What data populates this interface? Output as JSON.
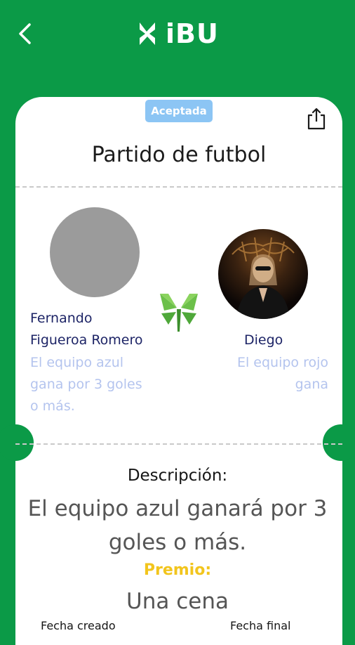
{
  "header": {
    "brand": "iBU"
  },
  "bet": {
    "status": "Aceptada",
    "title": "Partido de futbol",
    "left_player": {
      "name_line1": "Fernando",
      "name_line2": "Figueroa Romero",
      "condition_lines": [
        "El equipo azul",
        "gana por 3 goles",
        "o más."
      ]
    },
    "right_player": {
      "name": "Diego",
      "condition_lines": [
        "El equipo rojo",
        "gana"
      ]
    },
    "description_label": "Descripción:",
    "description_lines": [
      "El equipo azul ganará por 3",
      "goles o más."
    ],
    "prize_label": "Premio:",
    "prize": "Una cena",
    "created_label": "Fecha creado",
    "final_label": "Fecha final"
  },
  "colors": {
    "brand_green": "#0b9a47",
    "badge_blue": "#8cc5f4",
    "name_navy": "#1d2466",
    "condition_blue": "#b4c4ee",
    "prize_yellow": "#f2c51d"
  },
  "icons": {
    "back": "chevron-left-icon",
    "share": "share-icon",
    "logo": "clover-logo-icon"
  }
}
